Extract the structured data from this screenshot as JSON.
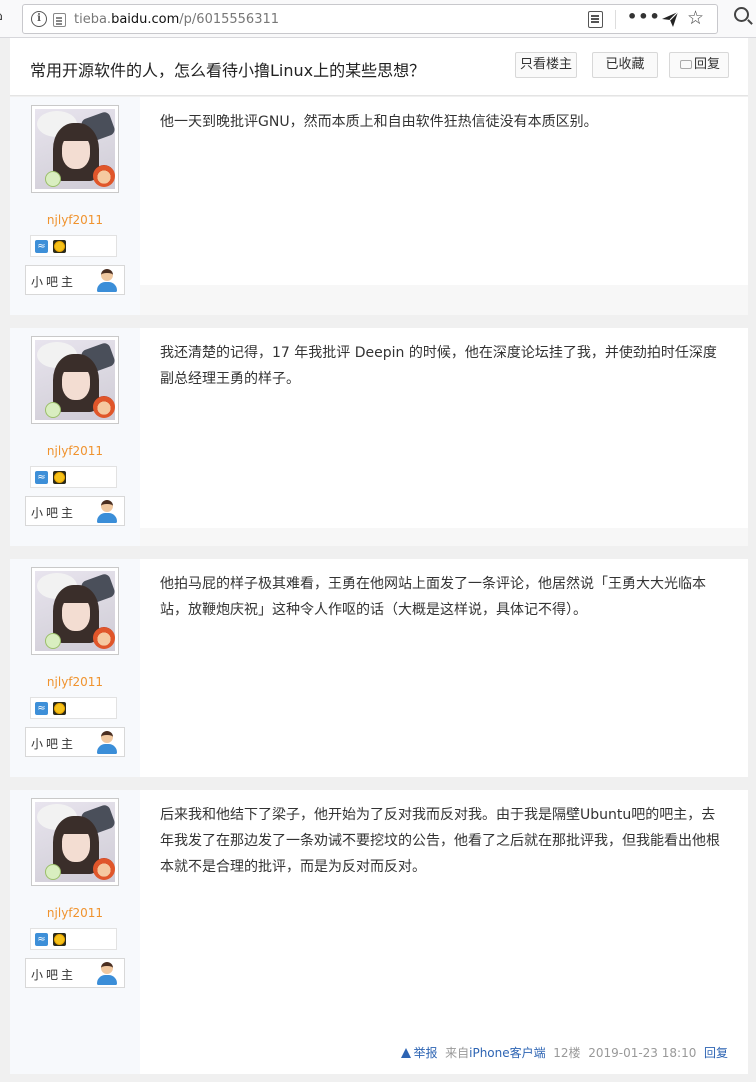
{
  "browser": {
    "url_prefix": "tieba.",
    "url_host": "baidu.com",
    "url_path": "/p/6015556311"
  },
  "header": {
    "title": "常用开源软件的人，怎么看待小撸Linux上的某些思想？",
    "only_op_label": "只看楼主",
    "favorited_label": "已收藏",
    "reply_label": "回复"
  },
  "posts": [
    {
      "username": "njlyf2011",
      "role": "小吧主",
      "text": "他一天到晚批评GNU，然而本质上和自由软件狂热信徒没有本质区别。"
    },
    {
      "username": "njlyf2011",
      "role": "小吧主",
      "text": "我还清楚的记得，17 年我批评 Deepin 的时候，他在深度论坛挂了我，并使劲拍时任深度副总经理王勇的样子。"
    },
    {
      "username": "njlyf2011",
      "role": "小吧主",
      "text": "他拍马屁的样子极其难看，王勇在他网站上面发了一条评论，他居然说「王勇大大光临本站，放鞭炮庆祝」这种令人作呕的话（大概是这样说，具体记不得）。"
    },
    {
      "username": "njlyf2011",
      "role": "小吧主",
      "text": "后来我和他结下了梁子，他开始为了反对我而反对我。由于我是隔壁Ubuntu吧的吧主，去年我发了在那边发了一条劝诫不要挖坟的公告，他看了之后就在那批评我，但我能看出他根本就不是合理的批评，而是为反对而反对。",
      "footer": {
        "report": "举报",
        "source_prefix": "来自",
        "source_client": "iPhone客户端",
        "floor": "12楼",
        "datetime": "2019-01-23 18:10",
        "reply": "回复"
      }
    }
  ]
}
